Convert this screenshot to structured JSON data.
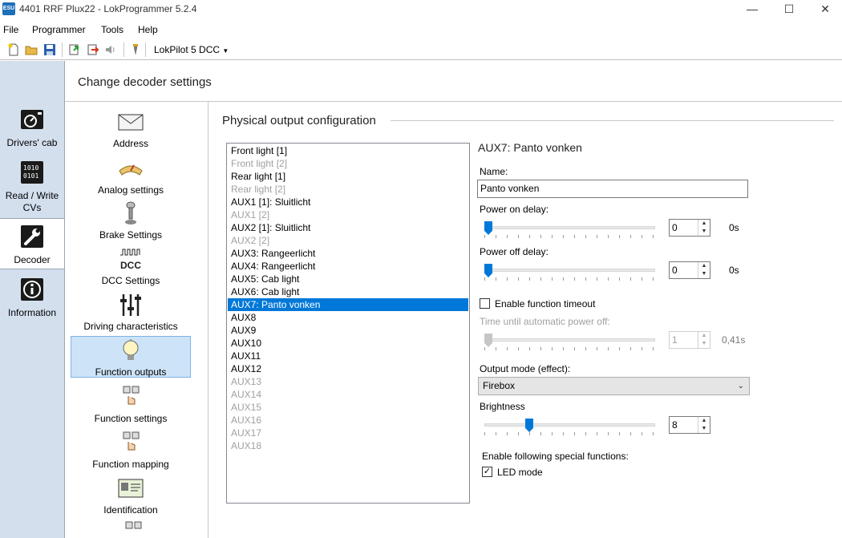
{
  "window": {
    "title": "4401 RRF Plux22 - LokProgrammer 5.2.4",
    "app_icon_text": "ESU",
    "controls": {
      "minimize": "—",
      "maximize": "☐",
      "close": "✕"
    }
  },
  "menu": [
    "File",
    "Programmer",
    "Tools",
    "Help"
  ],
  "toolbar": {
    "icons": [
      "new-file-icon",
      "open-folder-icon",
      "save-icon",
      "upload-icon",
      "download-icon",
      "sound-icon",
      "probe-icon"
    ],
    "decoder_type": "LokPilot 5 DCC"
  },
  "leftnav": {
    "items": [
      {
        "label": "Drivers' cab",
        "icon": "drivers-cab-icon"
      },
      {
        "label": "Read / Write CVs",
        "icon": "cv-icon"
      },
      {
        "label": "Decoder",
        "icon": "wrench-icon",
        "selected": true
      },
      {
        "label": "Information",
        "icon": "info-icon"
      }
    ]
  },
  "page": {
    "title": "Change decoder settings"
  },
  "settings": {
    "items": [
      {
        "label": "Address",
        "icon": "envelope-icon"
      },
      {
        "label": "Analog settings",
        "icon": "analog-gauge-icon"
      },
      {
        "label": "Brake Settings",
        "icon": "brake-lever-icon"
      },
      {
        "label": "DCC Settings",
        "icon": "dcc-icon",
        "icon_text": "DCC"
      },
      {
        "label": "Driving characteristics",
        "icon": "sliders-icon"
      },
      {
        "label": "Function outputs",
        "icon": "light-bulb-icon",
        "selected": true
      },
      {
        "label": "Function settings",
        "icon": "function-keys-icon"
      },
      {
        "label": "Function mapping",
        "icon": "function-mapping-icon"
      },
      {
        "label": "Identification",
        "icon": "id-card-icon"
      }
    ]
  },
  "section": {
    "title": "Physical output configuration"
  },
  "outputs": [
    {
      "label": "Front light [1]",
      "enabled": true
    },
    {
      "label": "Front light [2]",
      "enabled": false
    },
    {
      "label": "Rear light [1]",
      "enabled": true
    },
    {
      "label": "Rear light [2]",
      "enabled": false
    },
    {
      "label": "AUX1 [1]: Sluitlicht",
      "enabled": true
    },
    {
      "label": "AUX1 [2]",
      "enabled": false
    },
    {
      "label": "AUX2 [1]: Sluitlicht",
      "enabled": true
    },
    {
      "label": "AUX2 [2]",
      "enabled": false
    },
    {
      "label": "AUX3: Rangeerlicht",
      "enabled": true
    },
    {
      "label": "AUX4: Rangeerlicht",
      "enabled": true
    },
    {
      "label": "AUX5: Cab light",
      "enabled": true
    },
    {
      "label": "AUX6: Cab light",
      "enabled": true
    },
    {
      "label": "AUX7: Panto vonken",
      "enabled": true,
      "selected": true
    },
    {
      "label": "AUX8",
      "enabled": true
    },
    {
      "label": "AUX9",
      "enabled": true
    },
    {
      "label": "AUX10",
      "enabled": true
    },
    {
      "label": "AUX11",
      "enabled": true
    },
    {
      "label": "AUX12",
      "enabled": true
    },
    {
      "label": "AUX13",
      "enabled": false
    },
    {
      "label": "AUX14",
      "enabled": false
    },
    {
      "label": "AUX15",
      "enabled": false
    },
    {
      "label": "AUX16",
      "enabled": false
    },
    {
      "label": "AUX17",
      "enabled": false
    },
    {
      "label": "AUX18",
      "enabled": false
    }
  ],
  "detail": {
    "title": "AUX7: Panto vonken",
    "name_label": "Name:",
    "name_value": "Panto vonken",
    "power_on": {
      "label": "Power on delay:",
      "value": "0",
      "unit": "0s",
      "level": 0
    },
    "power_off": {
      "label": "Power off delay:",
      "value": "0",
      "unit": "0s",
      "level": 0
    },
    "timeout_checkbox": {
      "label": "Enable function timeout",
      "checked": false
    },
    "auto_off": {
      "label": "Time until automatic power off:",
      "value": "1",
      "unit": "0,41s",
      "level": 0,
      "disabled": true
    },
    "output_mode": {
      "label": "Output mode (effect):",
      "value": "Firebox"
    },
    "brightness": {
      "label": "Brightness",
      "value": "8",
      "level": 0.25
    },
    "special_functions": {
      "label": "Enable following special functions:"
    },
    "led_mode": {
      "label": "LED mode",
      "checked": true,
      "mark": "✓"
    }
  },
  "colors": {
    "accent": "#0078d7",
    "nav_bg": "#d4dfee",
    "selected_item": "#cde3f7"
  }
}
